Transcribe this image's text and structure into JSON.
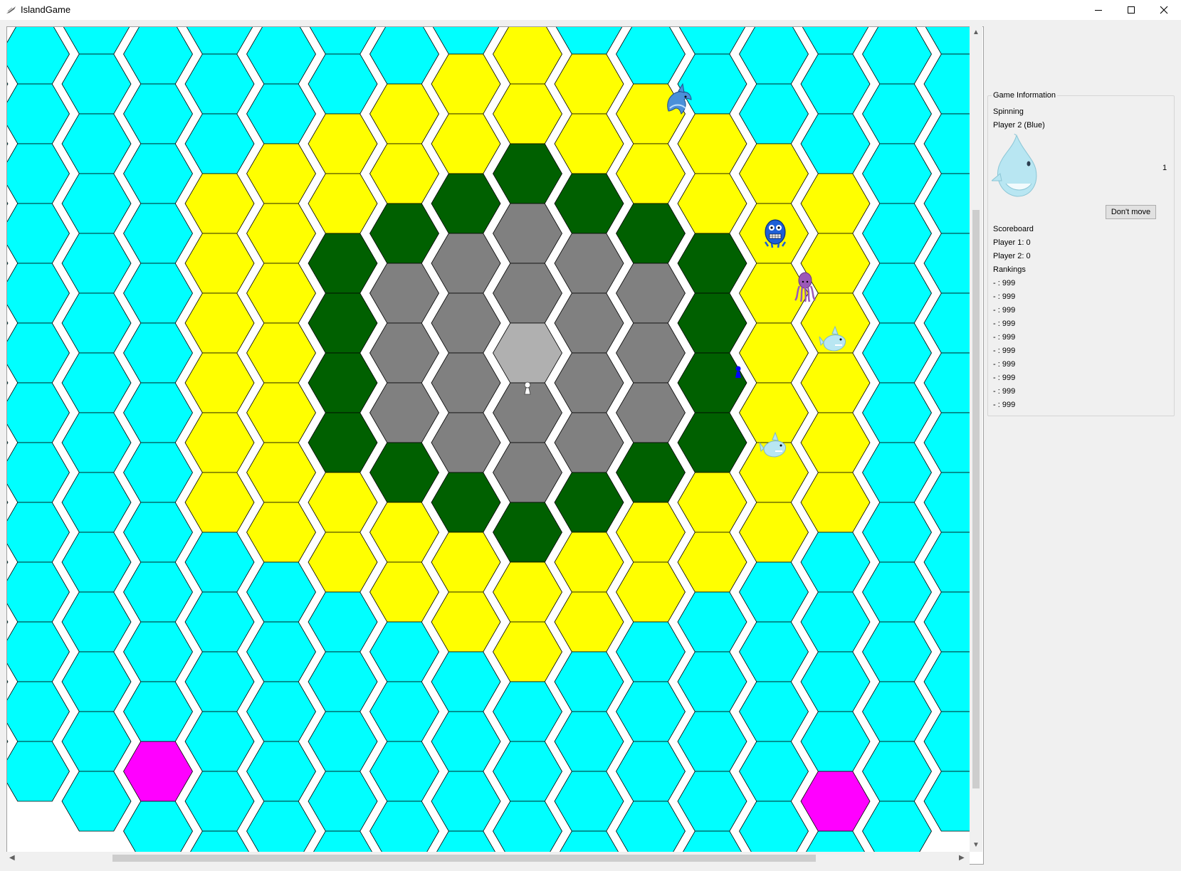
{
  "window": {
    "title": "IslandGame",
    "controls": [
      "minimize",
      "maximize",
      "close"
    ]
  },
  "board": {
    "tile_colors": {
      "sea": "#00ffff",
      "beach": "#ffff00",
      "forest": "#006000",
      "mountain": "#808080",
      "summit": "#b0b0b0",
      "safe_port": "#ff00ff",
      "tile_border": "#000000"
    },
    "pieces": [
      {
        "type": "dolphin",
        "icon": "dolphin-icon"
      },
      {
        "type": "sea-monster",
        "icon": "sea-monster-icon"
      },
      {
        "type": "octopus",
        "icon": "octopus-icon"
      },
      {
        "type": "shark",
        "icon": "shark-icon"
      },
      {
        "type": "shark",
        "icon": "shark-icon"
      },
      {
        "type": "player-pawn",
        "color": "#ffffff",
        "icon": "pawn-icon"
      },
      {
        "type": "player-pawn",
        "color": "#0000ff",
        "icon": "pawn-icon"
      }
    ]
  },
  "info": {
    "group_title": "Game Information",
    "phase": "Spinning",
    "current_player": "Player 2 (Blue)",
    "spinner_creature": "shark-icon",
    "spinner_value": "1",
    "dont_move_label": "Don't move",
    "scoreboard_title": "Scoreboard",
    "scores": [
      "Player 1: 0",
      "Player 2: 0"
    ],
    "rankings_title": "Rankings",
    "rankings": [
      "- : 999",
      "- : 999",
      "- : 999",
      "- : 999",
      "- : 999",
      "- : 999",
      "- : 999",
      "- : 999",
      "- : 999",
      "- : 999"
    ]
  }
}
